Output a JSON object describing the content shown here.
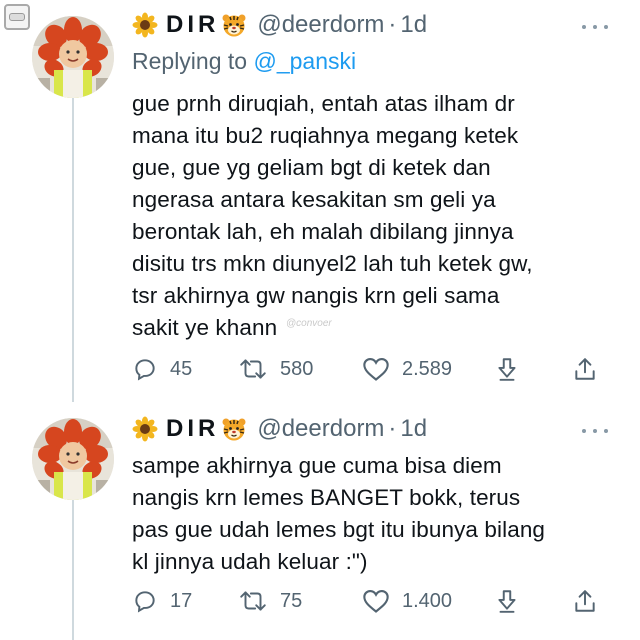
{
  "tweets": [
    {
      "display_name": "DIR",
      "handle": "@deerdorm",
      "separator": "·",
      "time": "1d",
      "reply_prefix": "Replying to",
      "reply_to": "@_panski",
      "body_lines": [
        "gue prnh diruqiah, entah atas ilham dr",
        "mana itu bu2 ruqiahnya megang ketek",
        "gue, gue yg geliam bgt di ketek dan",
        "ngerasa antara kesakitan sm geli ya",
        "berontak lah, eh malah dibilang jinnya",
        "disitu trs mkn diunyel2 lah tuh ketek gw,",
        "tsr akhirnya gw nangis krn geli sama",
        "sakit ye khann"
      ],
      "replies": "45",
      "retweets": "580",
      "likes": "2.589"
    },
    {
      "display_name": "DIR",
      "handle": "@deerdorm",
      "separator": "·",
      "time": "1d",
      "body_lines": [
        "sampe akhirnya gue cuma bisa diem",
        "nangis krn lemes BANGET bokk, terus",
        "pas gue udah lemes bgt itu ibunya bilang",
        "kl jinnya udah keluar :\")"
      ],
      "replies": "17",
      "retweets": "75",
      "likes": "1.400"
    }
  ],
  "watermark": "@convoer",
  "icons": {
    "corner": "minimize-badge-icon",
    "name_emoji_left": "sunflower-icon",
    "name_emoji_right": "tiger-face-icon",
    "more": "more-options-icon",
    "reply": "reply-bubble-icon",
    "retweet": "retweet-icon",
    "like": "heart-icon",
    "share": "share-icon",
    "download": "download-arrow-icon"
  },
  "colors": {
    "text": "#0f1419",
    "muted": "#536471",
    "link": "#1d9bf0",
    "thread_line": "#cfd9de"
  }
}
